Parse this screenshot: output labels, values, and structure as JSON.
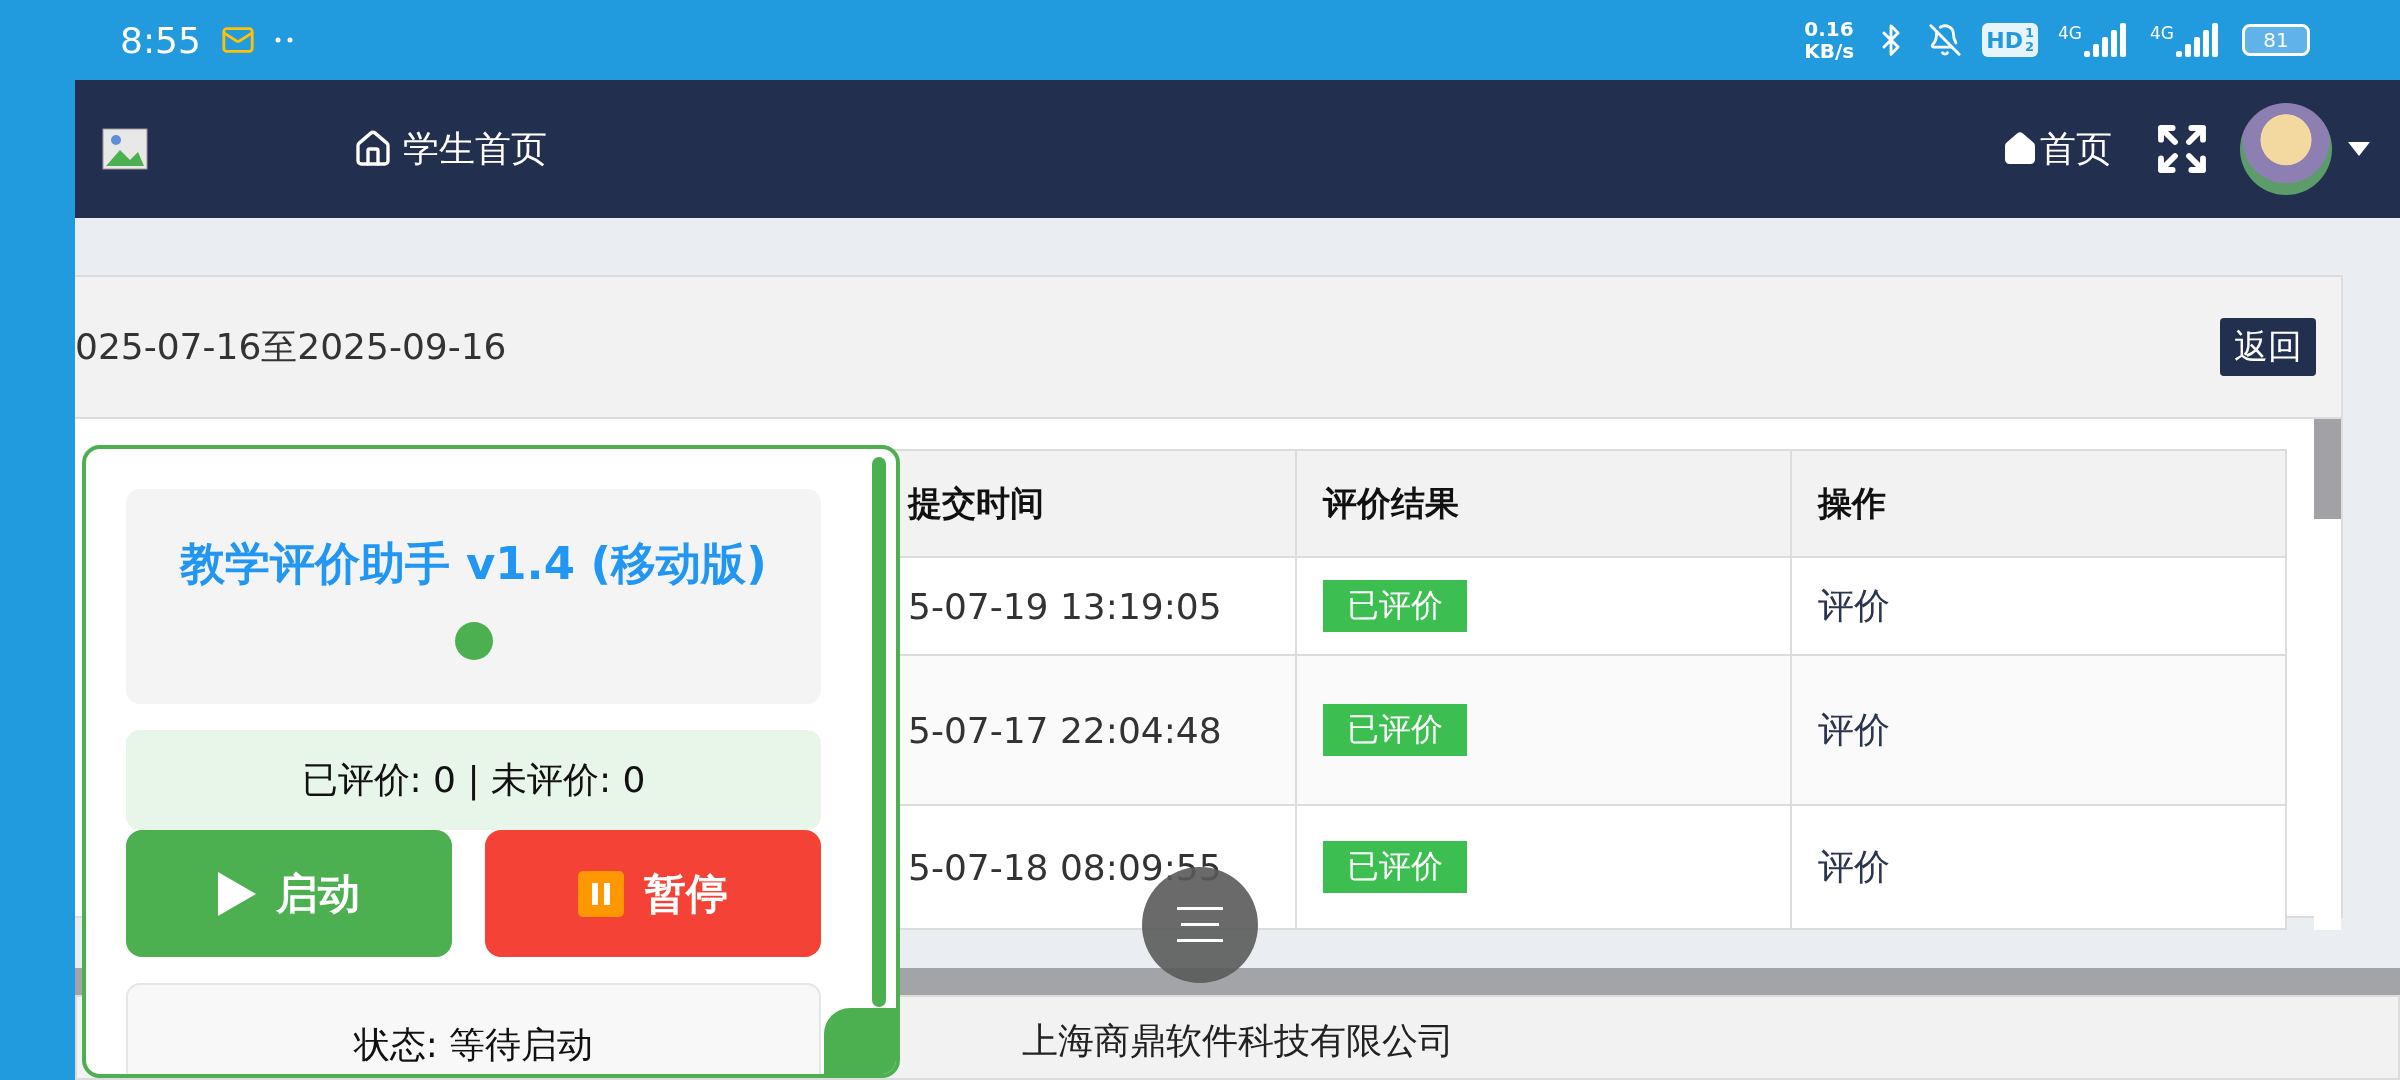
{
  "status_bar": {
    "time": "8:55",
    "network_speed": [
      "0.16",
      "KB/s"
    ],
    "hd_badge": {
      "label": "HD",
      "sup": "1",
      "sub": "2"
    },
    "sim_labels": [
      "4G",
      "4G"
    ],
    "battery": "81"
  },
  "header": {
    "nav_title": "学生首页",
    "home_link": "首页"
  },
  "card": {
    "date_range": "025-07-16至2025-09-16",
    "back_button": "返回"
  },
  "table": {
    "columns": [
      "提交时间",
      "评价结果",
      "操作"
    ],
    "rows": [
      {
        "time": "5-07-19 13:19:05",
        "result": "已评价",
        "action": "评价"
      },
      {
        "time": "5-07-17 22:04:48",
        "result": "已评价",
        "action": "评价"
      },
      {
        "time": "5-07-18 08:09:55",
        "result": "已评价",
        "action": "评价"
      }
    ]
  },
  "footer": "上海商鼎软件科技有限公司",
  "assistant_panel": {
    "title": "教学评价助手 v1.4 (移动版)",
    "stats": "已评价: 0 | 未评价: 0",
    "buttons": [
      {
        "kind": "start",
        "label": "启动"
      },
      {
        "kind": "pause",
        "label": "暂停"
      }
    ],
    "status": "状态: 等待启动"
  }
}
